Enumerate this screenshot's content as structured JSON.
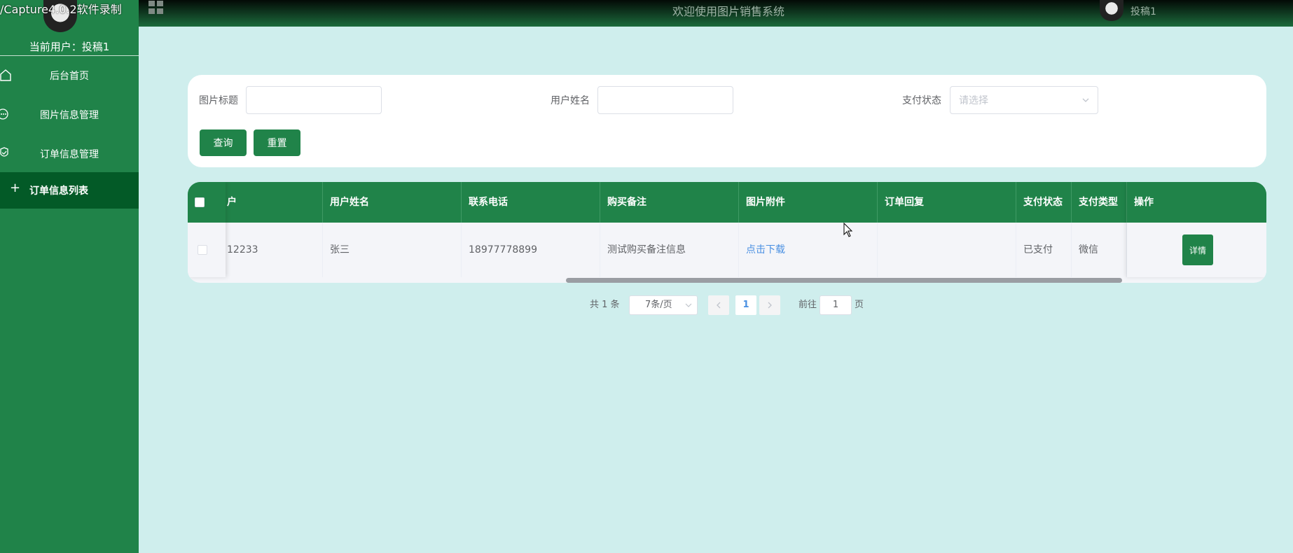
{
  "watermark": "/Capture4.0.2软件录制",
  "sidebar": {
    "current_user_label": "当前用户：",
    "current_user_name": "投稿1",
    "items": [
      {
        "label": "后台首页",
        "icon": "home-icon"
      },
      {
        "label": "图片信息管理",
        "icon": "more-icon"
      },
      {
        "label": "订单信息管理",
        "icon": "shield-icon"
      },
      {
        "label": "订单信息列表",
        "icon": "plus-icon"
      }
    ]
  },
  "header": {
    "title": "欢迎使用图片销售系统",
    "user": "投稿1",
    "menu_icon": "grid-icon"
  },
  "search": {
    "title_label": "图片标题",
    "title_value": "",
    "username_label": "用户姓名",
    "username_value": "",
    "pay_status_label": "支付状态",
    "pay_status_placeholder": "请选择",
    "query_button": "查询",
    "reset_button": "重置"
  },
  "table": {
    "columns": [
      "户",
      "用户姓名",
      "联系电话",
      "购买备注",
      "图片附件",
      "订单回复",
      "支付状态",
      "支付类型",
      "操作"
    ],
    "rows": [
      {
        "account": "12233",
        "username": "张三",
        "phone": "18977778899",
        "remark": "测试购买备注信息",
        "attachment": "点击下载",
        "reply": "",
        "pay_status": "已支付",
        "pay_type": "微信",
        "action": "详情"
      }
    ]
  },
  "pagination": {
    "total": "共 1 条",
    "page_size": "7条/页",
    "current_page": "1",
    "goto_label": "前往",
    "goto_value": "1",
    "page_suffix": "页"
  },
  "colors": {
    "primary": "#208349",
    "sidebar_active": "#035a27",
    "background": "#cfeeed",
    "link": "#4a90e2"
  }
}
